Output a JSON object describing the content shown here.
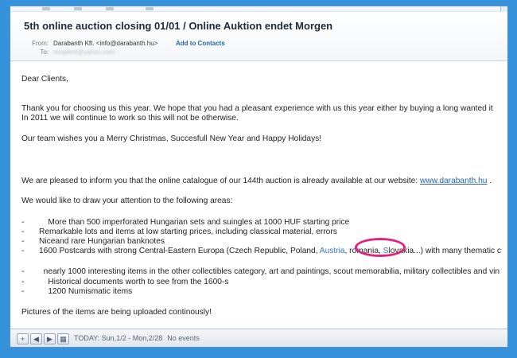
{
  "email": {
    "subject": "5th online auction closing 01/01 / Online Auktion endet Morgen",
    "from_label": "From:",
    "from_value": "Darabanth Kft. <info@darabanth.hu>",
    "add_contact": "Add to Contacts",
    "to_label": "To:",
    "to_value": "recipient@yahoo.com"
  },
  "body": {
    "greeting": "Dear Clients,",
    "p1_line1": "Thank you for choosing us this year. We hope that you had a pleasant experience with us this year either by buying a long wanted it",
    "p1_line2": "In 2011 we will continue to work so this will not be otherwise.",
    "p2": "Our team wishes you a Merry Christmas, Succesfull New Year and Happy Holidays!",
    "p3_text": "We are pleased to inform you that the online catalogue of our 144th auction is already available at our website: ",
    "p3_link": "www.darabanth.hu",
    "p3_end": " .",
    "p4": "We would like to draw your attention to the following areas:",
    "bullets": [
      "More than 500 imperforated Hungarian sets and suingles at 1000 HUF starting price",
      "Remarkable lots and items at low starting prices, including classical material, errors",
      "Niceand rare Hungarian banknotes"
    ],
    "bullet4_pre": "1600 Postcards with strong Central-Eastern Europa (Czech Republic, Poland, ",
    "bullet4_austria": "Austria",
    "bullet4_mid": ", romania, ",
    "bullet4_slovakia": "S",
    "bullet4_post": "lovakia...) with many thematic c",
    "bullets2": [
      "nearly 1000 interesting items in the other collectibles category, art and paintings, scout memorabilia, military collectibles and vin",
      "Historical documents worth to see from the 1600-s",
      "1200 Numismatic items"
    ],
    "closing": "Pictures of the items are being uploaded continously!"
  },
  "toolbar": {
    "today_label": "TODAY: Sun,1/2 - Mon,2/28",
    "events": "No events",
    "buttons": [
      "+",
      "◀",
      "▶",
      "▦"
    ]
  },
  "colors": {
    "frame": "#3592db",
    "highlight_circle": "#e0237d",
    "link": "#2b61b0"
  }
}
